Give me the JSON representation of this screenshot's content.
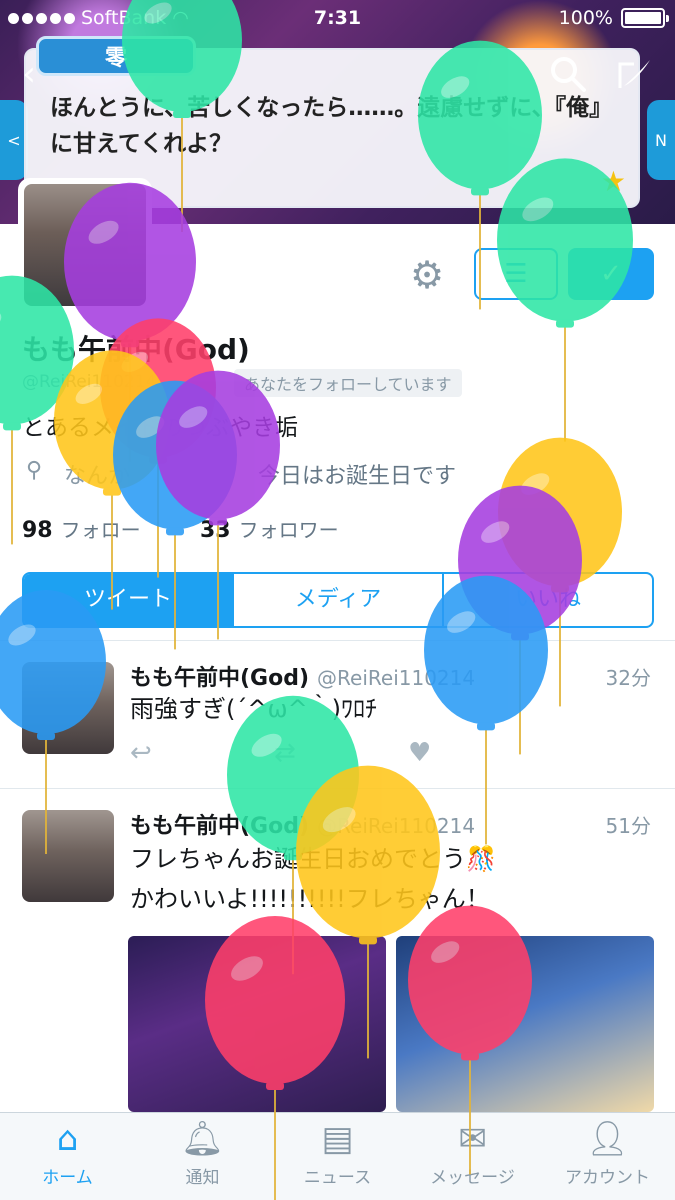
{
  "status_bar": {
    "carrier": "SoftBank",
    "time": "7:31",
    "battery": "100%",
    "battery_level": 1.0
  },
  "header": {
    "speaker": "零",
    "dialogue": "ほんとうに、苦しくなったら……。遠慮せずに、『俺』に甘えてくれよ？",
    "side_left": "<",
    "side_right": "N"
  },
  "profile": {
    "name": "もも午前中(God)",
    "handle": "@ReiRei110214",
    "follows_you": "あなたをフォローしています",
    "bio": "とあるメイドのつぶやき垢",
    "location": "なんか",
    "birthday": "今日はお誕生日です",
    "following_count": "98",
    "following_label": "フォロー",
    "followers_count": "33",
    "followers_label": "フォロワー"
  },
  "tabs": [
    {
      "label": "ツイート"
    },
    {
      "label": "メディア"
    },
    {
      "label": "いいね"
    }
  ],
  "tweets": [
    {
      "name": "もも午前中(God)",
      "handle": "@ReiRei110214",
      "time": "32分",
      "text": "雨強すぎ(´^ω^｀)ﾜﾛﾁ"
    },
    {
      "name": "もも午前中(God)",
      "handle": "@ReiRei110214",
      "time": "51分",
      "text_line1": "フレちゃんお誕生日おめでとう🎊",
      "text_line2": "かわいいよ!!!!!!!!!!フレちゃん！"
    }
  ],
  "tabbar": [
    {
      "label": "ホーム",
      "icon": "home-icon"
    },
    {
      "label": "通知",
      "icon": "bell-icon"
    },
    {
      "label": "ニュース",
      "icon": "news-icon"
    },
    {
      "label": "メッセージ",
      "icon": "mail-icon"
    },
    {
      "label": "アカウント",
      "icon": "person-icon"
    }
  ],
  "colors": {
    "accent": "#1da1f2",
    "muted": "#8899a6"
  },
  "balloon_colors": [
    "#2ee6a6",
    "#a63ee0",
    "#ff3f6a",
    "#ffc61a",
    "#2a9bf5"
  ]
}
